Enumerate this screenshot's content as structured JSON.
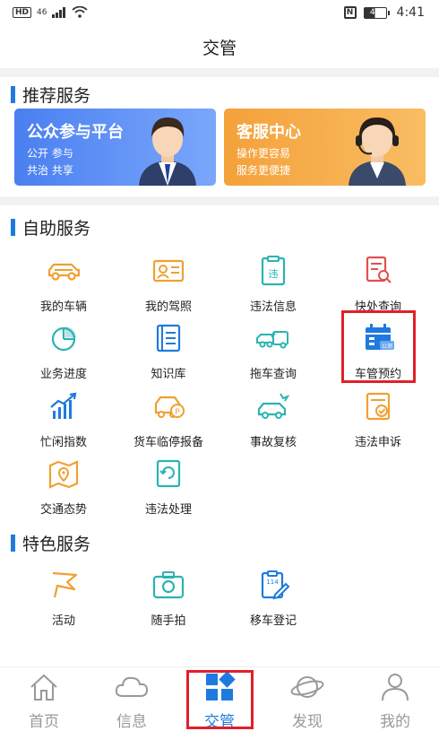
{
  "status_bar": {
    "network": "46",
    "battery": "48",
    "time": "4:41"
  },
  "header": {
    "title": "交管"
  },
  "recommended": {
    "title": "推荐服务",
    "banners": [
      {
        "title": "公众参与平台",
        "line1": "公开 参与",
        "line2": "共治 共享"
      },
      {
        "title": "客服中心",
        "line1": "操作更容易",
        "line2": "服务更便捷"
      }
    ]
  },
  "self_service": {
    "title": "自助服务",
    "items": [
      {
        "label": "我的车辆",
        "icon": "car-icon"
      },
      {
        "label": "我的驾照",
        "icon": "license-icon"
      },
      {
        "label": "违法信息",
        "icon": "violation-clipboard-icon"
      },
      {
        "label": "快处查询",
        "icon": "quick-search-icon"
      },
      {
        "label": "业务进度",
        "icon": "pie-progress-icon"
      },
      {
        "label": "知识库",
        "icon": "book-icon"
      },
      {
        "label": "拖车查询",
        "icon": "tow-truck-icon"
      },
      {
        "label": "车管预约",
        "icon": "calendar-appointment-icon"
      },
      {
        "label": "忙闲指数",
        "icon": "trend-chart-icon"
      },
      {
        "label": "货车临停报备",
        "icon": "truck-parking-icon"
      },
      {
        "label": "事故复核",
        "icon": "accident-review-icon"
      },
      {
        "label": "违法申诉",
        "icon": "appeal-icon"
      },
      {
        "label": "交通态势",
        "icon": "traffic-map-icon"
      },
      {
        "label": "违法处理",
        "icon": "violation-handle-icon"
      }
    ],
    "calendar_badge": "公测"
  },
  "special_service": {
    "title": "特色服务",
    "items": [
      {
        "label": "活动",
        "icon": "flag-icon"
      },
      {
        "label": "随手拍",
        "icon": "camera-icon"
      },
      {
        "label": "移车登记",
        "icon": "move-car-register-icon"
      }
    ]
  },
  "bottom_nav": [
    {
      "label": "首页",
      "icon": "home-icon"
    },
    {
      "label": "信息",
      "icon": "cloud-icon"
    },
    {
      "label": "交管",
      "icon": "traffic-management-icon",
      "active": true
    },
    {
      "label": "发现",
      "icon": "planet-icon"
    },
    {
      "label": "我的",
      "icon": "user-icon"
    }
  ],
  "colors": {
    "accent": "#1f7ae0",
    "icon_orange": "#f0a030",
    "icon_teal": "#2bb3b3",
    "icon_red": "#e05050",
    "highlight": "#e0202a"
  }
}
